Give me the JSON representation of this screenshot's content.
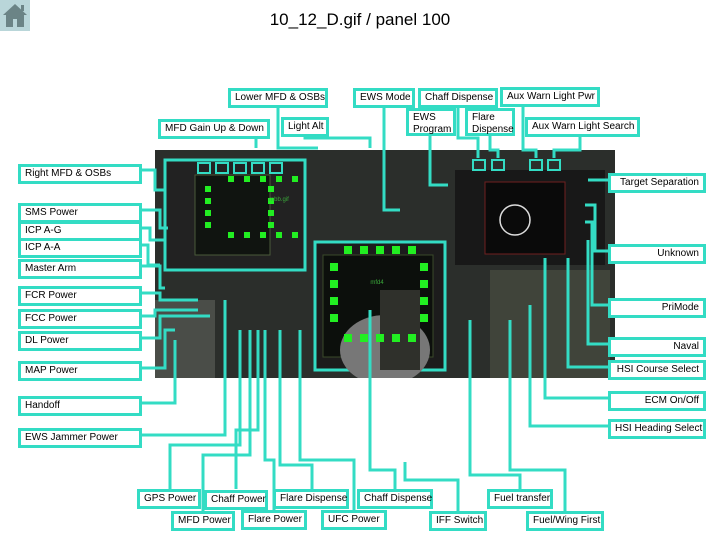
{
  "title": "10_12_D.gif / panel 100",
  "home_icon": "home-icon",
  "labels": {
    "lower_mfd_osbs": "Lower MFD & OSBs",
    "ews_mode": "EWS Mode",
    "chaff_dispense_top": "Chaff Dispense",
    "aux_warn_light_pwr": "Aux Warn Light Pwr",
    "mfd_gain": "MFD Gain Up & Down",
    "light_alt": "Light Alt",
    "ews_program": "EWS Program",
    "flare_dispense_top": "Flare Dispense",
    "aux_warn_light_search": "Aux Warn Light Search",
    "right_mfd_osbs": "Right MFD & OSBs",
    "target_separation": "Target Separation",
    "sms_power": "SMS Power",
    "icp_ag": "ICP A-G",
    "icp_aa": "ICP A-A",
    "unknown": "Unknown",
    "master_arm": "Master Arm",
    "fcr_power": "FCR Power",
    "primode": "PriMode",
    "fcc_power": "FCC Power",
    "dl_power": "DL Power",
    "naval": "Naval",
    "map_power": "MAP Power",
    "hsi_course_select": "HSI Course Select",
    "handoff": "Handoff",
    "ecm_onoff": "ECM On/Off",
    "ews_jammer_power": "EWS Jammer Power",
    "hsi_heading_select": "HSI Heading Select",
    "gps_power": "GPS Power",
    "chaff_power": "Chaff Power",
    "flare_dispense_bottom": "Flare Dispense",
    "chaff_dispense_bottom": "Chaff Dispense",
    "fuel_transfer": "Fuel transfer",
    "mfd_power": "MFD Power",
    "flare_power": "Flare Power",
    "ufc_power": "UFC Power",
    "iff_switch": "IFF Switch",
    "fuel_wing_first": "Fuel/Wing First"
  },
  "screens": {
    "left_mfd_text": "mbb.gif",
    "center_mfd_text": "mfd4"
  },
  "colors": {
    "highlight": "#33dcc4",
    "osb_green": "#22ee22"
  }
}
